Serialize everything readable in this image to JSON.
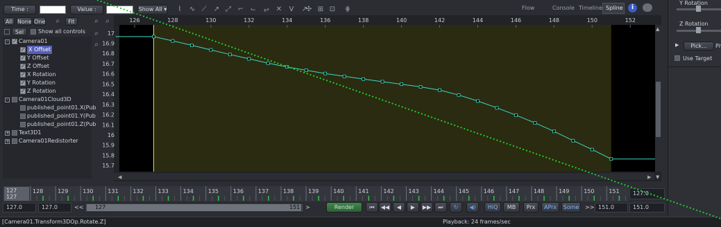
{
  "toolbar": {
    "time_label": "Time :",
    "time_value": "",
    "value_label": "Value :",
    "value_value": "",
    "show_all": "Show All ▾"
  },
  "tabs": {
    "flow": "Flow",
    "console": "Console",
    "timeline": "Timeline",
    "spline": "Spline"
  },
  "left_buttons": {
    "all": "All",
    "none": "None",
    "one": "One",
    "fit": "Fit",
    "sel": "Sel",
    "show_all_controls": "Show all controls"
  },
  "tree": [
    {
      "label": "Camera01",
      "level": 0,
      "expander": "-",
      "checked": true
    },
    {
      "label": "X Offset",
      "level": 1,
      "checked": true,
      "selected": true
    },
    {
      "label": "Y Offset",
      "level": 1,
      "checked": true
    },
    {
      "label": "Z Offset",
      "level": 1,
      "checked": true
    },
    {
      "label": "X Rotation",
      "level": 1,
      "checked": true
    },
    {
      "label": "Y Rotation",
      "level": 1,
      "checked": true
    },
    {
      "label": "Z Rotation",
      "level": 1,
      "checked": true
    },
    {
      "label": "Camera01Cloud3D",
      "level": 0,
      "expander": "-",
      "checked": false
    },
    {
      "label": "published_point01.X(Pub",
      "level": 1,
      "checked": false
    },
    {
      "label": "published_point01.Y(Pub",
      "level": 1,
      "checked": false
    },
    {
      "label": "published_point01.Z(Pub",
      "level": 1,
      "checked": false
    },
    {
      "label": "Text3D1",
      "level": 0,
      "expander": "+",
      "checked": false
    },
    {
      "label": "Camera01Redistorter",
      "level": 0,
      "expander": "+",
      "checked": false
    }
  ],
  "graph": {
    "x_ticks": [
      "126",
      "128",
      "130",
      "132",
      "134",
      "136",
      "138",
      "140",
      "142",
      "144",
      "146",
      "148",
      "150",
      "152"
    ],
    "y_ticks": [
      "17",
      "16.9",
      "16.8",
      "16.7",
      "16.6",
      "16.5",
      "16.4",
      "16.3",
      "16.2",
      "16.1",
      "16",
      "15.9",
      "15.8",
      "15.7"
    ],
    "curve_color": "#3fd9c4",
    "points": [
      [
        125.0,
        16.965
      ],
      [
        127.0,
        16.965
      ],
      [
        128.0,
        16.923
      ],
      [
        129.0,
        16.88
      ],
      [
        130.0,
        16.835
      ],
      [
        131.0,
        16.79
      ],
      [
        132.0,
        16.747
      ],
      [
        133.0,
        16.705
      ],
      [
        134.0,
        16.668
      ],
      [
        135.0,
        16.635
      ],
      [
        136.0,
        16.603
      ],
      [
        137.0,
        16.575
      ],
      [
        138.0,
        16.548
      ],
      [
        139.0,
        16.523
      ],
      [
        140.0,
        16.498
      ],
      [
        141.0,
        16.472
      ],
      [
        142.0,
        16.44
      ],
      [
        143.0,
        16.392
      ],
      [
        144.0,
        16.333
      ],
      [
        145.0,
        16.266
      ],
      [
        146.0,
        16.195
      ],
      [
        147.0,
        16.118
      ],
      [
        148.0,
        16.035
      ],
      [
        149.0,
        15.944
      ],
      [
        150.0,
        15.857
      ],
      [
        151.0,
        15.764
      ],
      [
        153.5,
        15.764
      ]
    ],
    "key_x": [
      127,
      128,
      129,
      130,
      131,
      132,
      133,
      134,
      135,
      136,
      137,
      138,
      139,
      140,
      141,
      142,
      143,
      144,
      145,
      146,
      147,
      148,
      149,
      150,
      151
    ]
  },
  "timeline": {
    "ticks": [
      "127",
      "128",
      "129",
      "130",
      "131",
      "132",
      "133",
      "134",
      "135",
      "136",
      "137",
      "138",
      "139",
      "140",
      "141",
      "142",
      "143",
      "144",
      "145",
      "146",
      "147",
      "148",
      "149",
      "150",
      "151"
    ],
    "current_top": "127",
    "current_bottom": "127",
    "end_value": "127.0"
  },
  "transport": {
    "global_start": "127.0",
    "render_start": "127.0",
    "range_start": "127",
    "range_end": "151",
    "render": "Render",
    "hiq": "HiQ",
    "mb": "MB",
    "prx": "Prx",
    "aprx": "APrx",
    "some": "Some",
    "render_end": "151.0",
    "global_end": "151.0"
  },
  "status": {
    "left": "[Camera01.Transform3DOp.Rotate.Z]",
    "playback": "Playback: 24 frames/sec"
  },
  "right_panel": {
    "y_rotation": "Y Rotation",
    "z_rotation": "Z Rotation",
    "pick": "Pick...",
    "pivot": "Piv",
    "use_target": "Use Target"
  },
  "colors": {
    "curve": "#3fd9c4",
    "playhead": "#e6e04a",
    "selection_overlay": "#2a2b10"
  }
}
